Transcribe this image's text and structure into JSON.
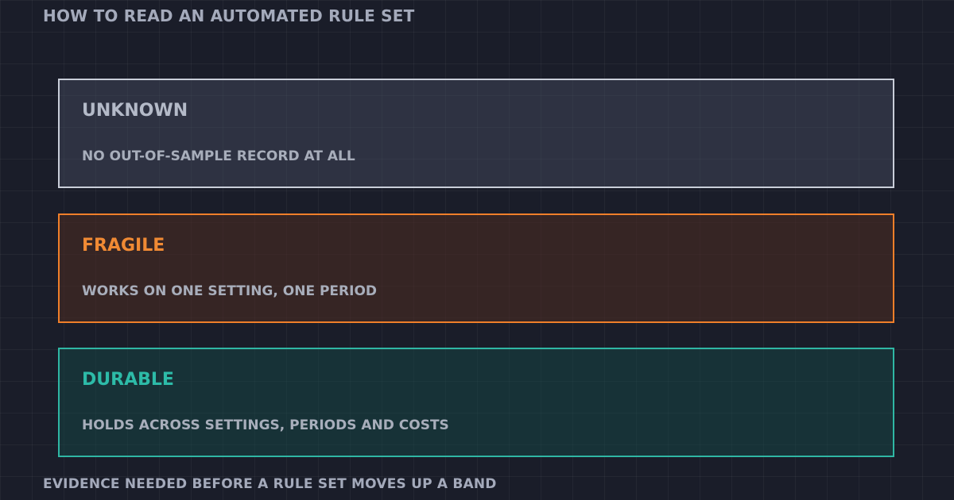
{
  "title": "HOW TO READ AN AUTOMATED RULE SET",
  "bands": [
    {
      "name": "UNKNOWN",
      "description": "NO OUT-OF-SAMPLE RECORD AT ALL",
      "border_color": "#c9ced9",
      "label_color": "#b4bac8"
    },
    {
      "name": "FRAGILE",
      "description": "WORKS ON ONE SETTING, ONE PERIOD",
      "border_color": "#f07f2a",
      "label_color": "#f08a34"
    },
    {
      "name": "DURABLE",
      "description": "HOLDS ACROSS SETTINGS, PERIODS AND COSTS",
      "border_color": "#2fb7a4",
      "label_color": "#2dbba8"
    }
  ],
  "footer": "EVIDENCE NEEDED BEFORE A RULE SET MOVES UP A BAND"
}
